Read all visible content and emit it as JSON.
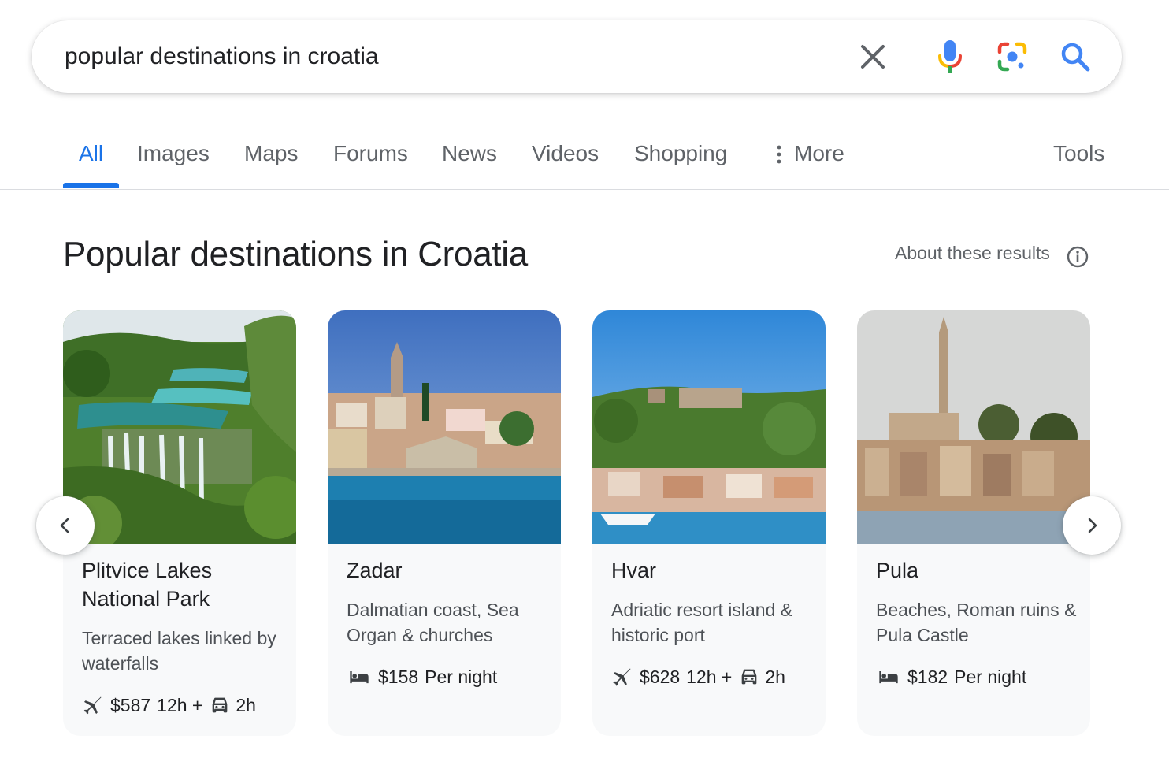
{
  "search": {
    "query": "popular destinations in croatia"
  },
  "tabs": {
    "items": [
      {
        "label": "All",
        "active": true
      },
      {
        "label": "Images",
        "active": false
      },
      {
        "label": "Maps",
        "active": false
      },
      {
        "label": "Forums",
        "active": false
      },
      {
        "label": "News",
        "active": false
      },
      {
        "label": "Videos",
        "active": false
      },
      {
        "label": "Shopping",
        "active": false
      }
    ],
    "more_label": "More",
    "tools_label": "Tools"
  },
  "section": {
    "title": "Popular destinations in Croatia",
    "about_label": "About these results"
  },
  "cards": [
    {
      "title": "Plitvice Lakes National Park",
      "description": "Terraced lakes linked by waterfalls",
      "meta_type": "travel",
      "price": "$587",
      "flight_time": "12h +",
      "drive_time": "2h"
    },
    {
      "title": "Zadar",
      "description": "Dalmatian coast, Sea Organ & churches",
      "meta_type": "hotel",
      "price": "$158",
      "price_unit": "Per night"
    },
    {
      "title": "Hvar",
      "description": "Adriatic resort island & historic port",
      "meta_type": "travel",
      "price": "$628",
      "flight_time": "12h +",
      "drive_time": "2h"
    },
    {
      "title": "Pula",
      "description": "Beaches, Roman ruins & Pula Castle",
      "meta_type": "hotel",
      "price": "$182",
      "price_unit": "Per night"
    }
  ],
  "colors": {
    "accent": "#1a73e8",
    "text_primary": "#202124",
    "text_secondary": "#5f6368",
    "card_bg": "#f8f9fa"
  },
  "icons": {
    "clear": "close-icon",
    "voice": "microphone-icon",
    "lens": "google-lens-icon",
    "search": "search-icon",
    "more": "vertical-dots-icon",
    "info": "info-icon",
    "flight": "airplane-icon",
    "car": "car-icon",
    "hotel": "bed-icon",
    "prev": "chevron-left-icon",
    "next": "chevron-right-icon"
  }
}
